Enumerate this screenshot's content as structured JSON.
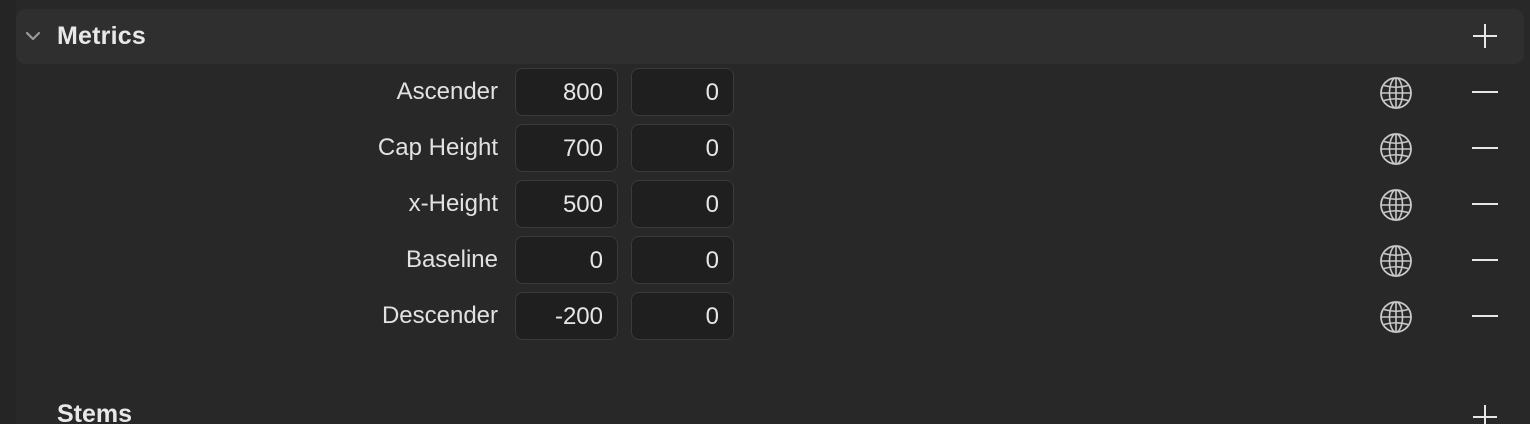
{
  "metrics": {
    "title": "Metrics",
    "rows": [
      {
        "label": "Ascender",
        "value": "800",
        "overshoot": "0"
      },
      {
        "label": "Cap Height",
        "value": "700",
        "overshoot": "0"
      },
      {
        "label": "x-Height",
        "value": "500",
        "overshoot": "0"
      },
      {
        "label": "Baseline",
        "value": "0",
        "overshoot": "0"
      },
      {
        "label": "Descender",
        "value": "-200",
        "overshoot": "0"
      }
    ],
    "expanded": true
  },
  "stems": {
    "title": "Stems"
  },
  "icons": {
    "collapse": "chevron-down-icon",
    "add": "plus-icon",
    "remove": "minus-icon",
    "localize": "globe-icon"
  },
  "colors": {
    "background": "#282828",
    "header_background": "#2f2f2f",
    "field_background": "#1f1f1f",
    "text": "#e6e6e6"
  }
}
